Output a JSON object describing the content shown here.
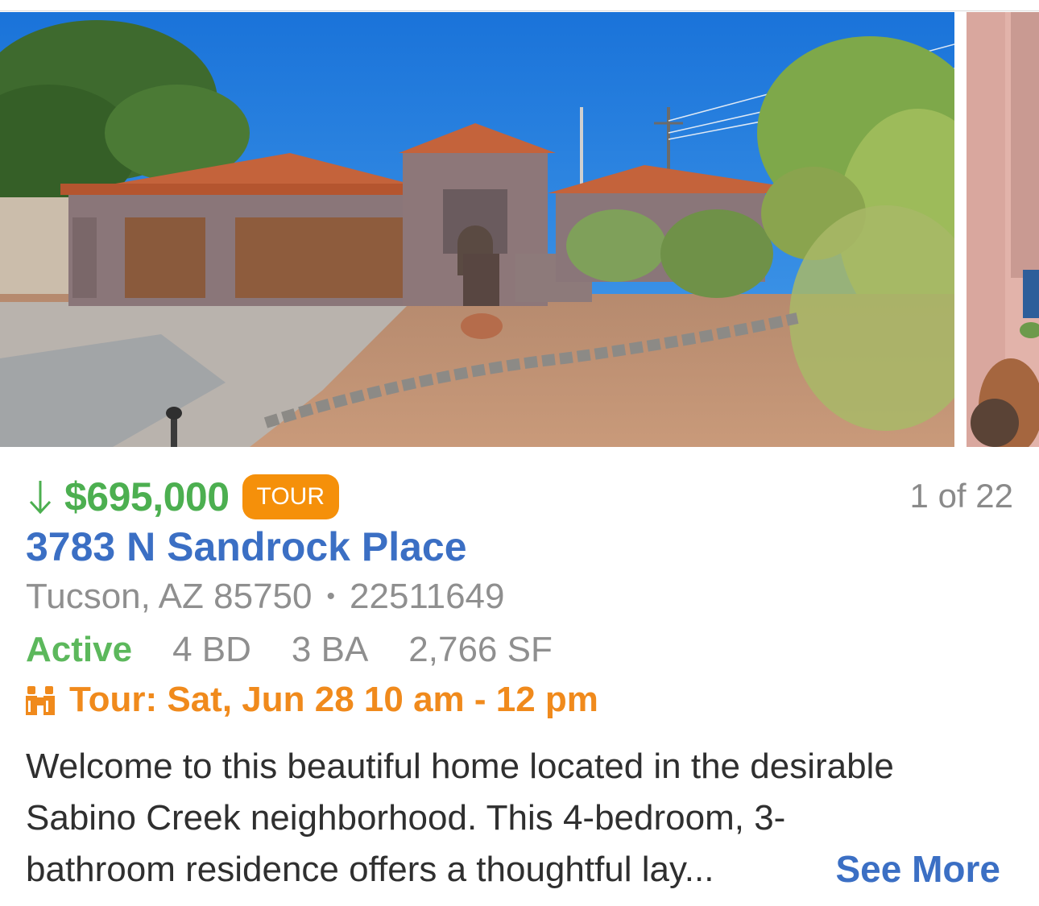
{
  "listing": {
    "price": "$695,000",
    "price_direction": "down",
    "tour_badge": "TOUR",
    "photo_counter": "1 of 22",
    "address": "3783 N Sandrock Place",
    "city_state_zip": "Tucson, AZ 85750",
    "separator": "•",
    "mls_number": "22511649",
    "status": "Active",
    "beds": "4 BD",
    "baths": "3 BA",
    "sqft": "2,766 SF",
    "tour_time": "Tour: Sat, Jun 28 10 am - 12 pm",
    "description_lines": [
      "Welcome to this beautiful home located in the desirable",
      "Sabino Creek neighborhood. This 4-bedroom, 3-",
      "bathroom residence offers a thoughtful lay..."
    ],
    "see_more": "See More"
  },
  "colors": {
    "price": "#4caf50",
    "tour_badge_bg": "#f5900a",
    "address": "#3b6fc4",
    "status": "#5cb85c",
    "tour_text": "#f08a1c",
    "muted": "#8f8f8f"
  },
  "icons": {
    "price_direction": "arrow-down-icon",
    "tour": "binoculars-icon"
  }
}
